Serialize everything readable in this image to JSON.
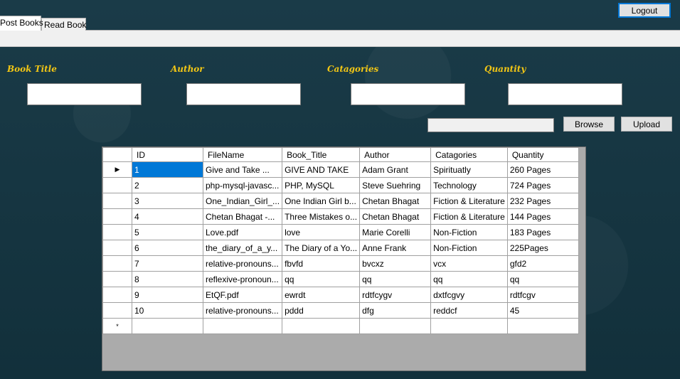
{
  "header": {
    "logout_label": "Logout"
  },
  "tabs": [
    {
      "label": "Post Books",
      "active": true
    },
    {
      "label": "Read Book",
      "active": false
    }
  ],
  "form": {
    "book_title_label": "Book Title",
    "author_label": "Author",
    "categories_label": "Catagories",
    "quantity_label": "Quantity",
    "book_title_value": "",
    "author_value": "",
    "categories_value": "",
    "quantity_value": "",
    "file_path_value": "",
    "browse_label": "Browse",
    "upload_label": "Upload"
  },
  "grid": {
    "columns": [
      "ID",
      "FileName",
      "Book_Title",
      "Author",
      "Catagories",
      "Quantity"
    ],
    "current_row_marker": "▶",
    "new_row_marker": "*",
    "rows": [
      [
        "1",
        "Give and Take ...",
        "GIVE AND TAKE",
        "Adam Grant",
        "Spirituatly",
        "260 Pages"
      ],
      [
        "2",
        "php-mysql-javasc...",
        "PHP, MySQL",
        "Steve Suehring",
        "Technology",
        "724 Pages"
      ],
      [
        "3",
        "One_Indian_Girl_...",
        "One Indian Girl b...",
        "Chetan Bhagat",
        "Fiction & Literature",
        "232 Pages"
      ],
      [
        "4",
        "Chetan Bhagat -...",
        "Three Mistakes o...",
        " Chetan Bhagat",
        "Fiction & Literature",
        "144 Pages"
      ],
      [
        "5",
        "Love.pdf",
        "love",
        "Marie Corelli",
        "Non-Fiction",
        "183 Pages"
      ],
      [
        "6",
        "the_diary_of_a_y...",
        "The Diary of a Yo...",
        "Anne Frank",
        "Non-Fiction",
        "225Pages"
      ],
      [
        "7",
        "relative-pronouns...",
        "fbvfd",
        "bvcxz",
        "vcx",
        "gfd2"
      ],
      [
        "8",
        "reflexive-pronoun...",
        "qq",
        "qq",
        "qq",
        "qq"
      ],
      [
        "9",
        "EtQF.pdf",
        "ewrdt",
        "rdtfcygv",
        "dxtfcgvy",
        "rdtfcgv"
      ],
      [
        "10",
        "relative-pronouns...",
        "pddd",
        "dfg",
        "reddcf",
        "45"
      ]
    ]
  }
}
